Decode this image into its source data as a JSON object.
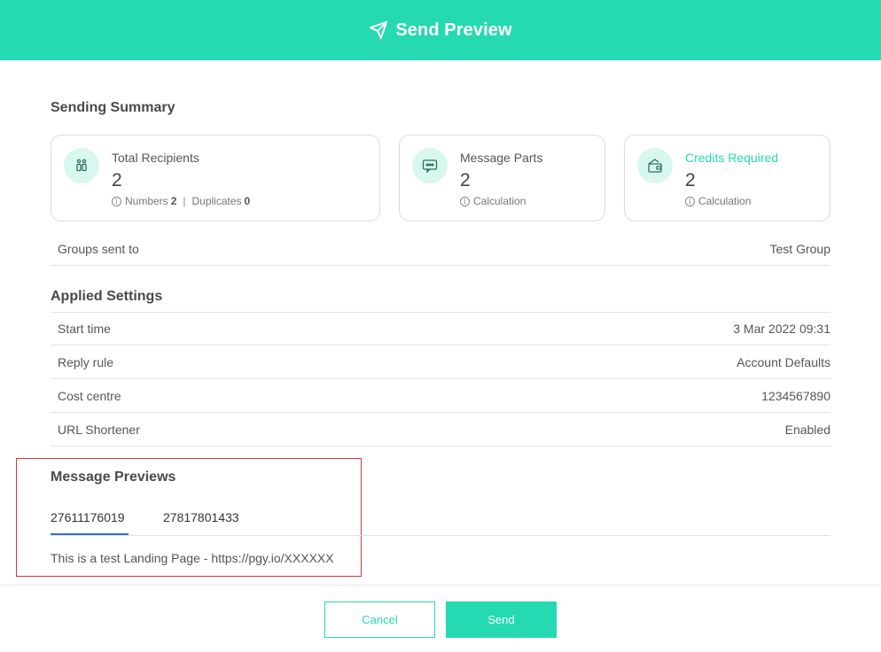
{
  "header": {
    "title": "Send Preview"
  },
  "summary": {
    "title": "Sending Summary",
    "cards": [
      {
        "label": "Total Recipients",
        "value": "2",
        "numbers_label": "Numbers",
        "numbers_value": "2",
        "separator": "|",
        "duplicates_label": "Duplicates",
        "duplicates_value": "0"
      },
      {
        "label": "Message Parts",
        "value": "2",
        "sub": "Calculation"
      },
      {
        "label": "Credits Required",
        "value": "2",
        "sub": "Calculation"
      }
    ],
    "groups": {
      "label": "Groups sent to",
      "value": "Test Group"
    }
  },
  "settings": {
    "title": "Applied Settings",
    "rows": [
      {
        "label": "Start time",
        "value": "3 Mar 2022 09:31"
      },
      {
        "label": "Reply rule",
        "value": "Account Defaults"
      },
      {
        "label": "Cost centre",
        "value": "1234567890"
      },
      {
        "label": "URL Shortener",
        "value": "Enabled"
      }
    ]
  },
  "previews": {
    "title": "Message Previews",
    "tabs": [
      "27611176019",
      "27817801433"
    ],
    "active_tab": "27611176019",
    "text": "This is a test Landing Page - https://pgy.io/XXXXXX"
  },
  "footer": {
    "cancel_label": "Cancel",
    "send_label": "Send"
  },
  "colors": {
    "accent": "#25d9b1",
    "tab_active": "#2f73d9",
    "highlight": "#d9363e"
  },
  "icons": {
    "header": "paper-plane-icon",
    "recipients": "recipients-icon",
    "parts": "message-bubble-icon",
    "credits": "wallet-icon",
    "info": "info-icon"
  }
}
